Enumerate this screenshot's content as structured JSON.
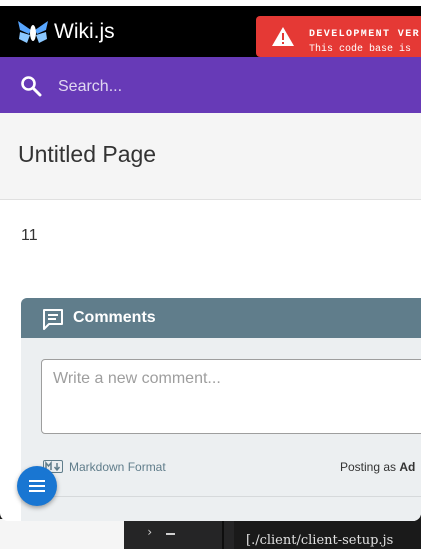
{
  "app": {
    "brand": "Wiki.js",
    "dev_banner": {
      "line1": "DEVELOPMENT VER",
      "line2": "This code base is"
    }
  },
  "search": {
    "placeholder": "Search..."
  },
  "page": {
    "title": "Untitled Page",
    "content": "11"
  },
  "comments": {
    "title": "Comments",
    "new_comment_placeholder": "Write a new comment...",
    "markdown_label": "Markdown Format",
    "posting_as_label": "Posting as",
    "posting_as_user": "Ad"
  },
  "terminal": {
    "chevron": "›",
    "path_text": "[./client/client-setup.js"
  },
  "colors": {
    "header": "#000000",
    "search_bar": "#673ab7",
    "dev_banner": "#e53935",
    "comments_bar": "#607d8b",
    "fab": "#1976d2"
  }
}
